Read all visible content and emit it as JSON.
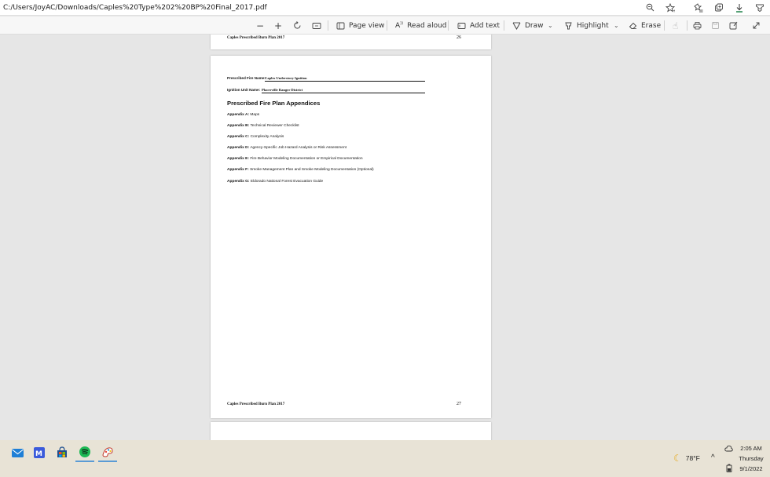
{
  "address_bar": {
    "url": "C:/Users/JoyAC/Downloads/Caples%20Type%202%20BP%20Final_2017.pdf",
    "icons": [
      "zoom-icon",
      "favorite-star-icon",
      "favorites-list-icon",
      "collections-icon",
      "downloads-icon",
      "extensions-icon"
    ]
  },
  "toolbar": {
    "page_view_label": "Page view",
    "read_aloud_label": "Read aloud",
    "add_text_label": "Add text",
    "draw_label": "Draw",
    "highlight_label": "Highlight",
    "erase_label": "Erase"
  },
  "page_26": {
    "footer_title": "Caples Prescribed Burn Plan 2017",
    "page_number": "26"
  },
  "page_27": {
    "fire_name_label": "Prescribed Fire Name:",
    "fire_name_value": "Caples Understory Ignition",
    "unit_name_label": "Ignition Unit Name:",
    "unit_name_value": "Placerville Ranger District",
    "section_title": "Prescribed Fire Plan Appendices",
    "appendices": [
      {
        "label": "Appendix A:",
        "text": "Maps"
      },
      {
        "label": "Appendix B:",
        "text": "Technical Reviewer Checklist"
      },
      {
        "label": "Appendix C:",
        "text": "Complexity Analysis"
      },
      {
        "label": "Appendix D:",
        "text": "Agency-Specific Job Hazard Analysis or Risk Assessment"
      },
      {
        "label": "Appendix E:",
        "text": "Fire Behavior Modeling Documentation or Empirical Documentation"
      },
      {
        "label": "Appendix F:",
        "text": "Smoke Management Plan and Smoke Modeling Documentation (Optional)"
      },
      {
        "label": "Appendix G:",
        "text": "Eldorado National Forest Evacuation Guide"
      }
    ],
    "footer_title": "Caples Prescribed Burn Plan 2017",
    "page_number": "27"
  },
  "taskbar": {
    "apps": [
      "mail-icon",
      "tasks-icon",
      "store-icon",
      "spotify-icon",
      "paint-icon"
    ],
    "weather_temp": "78°F",
    "time": "2:05 AM",
    "day": "Thursday",
    "date": "9/1/2022"
  }
}
